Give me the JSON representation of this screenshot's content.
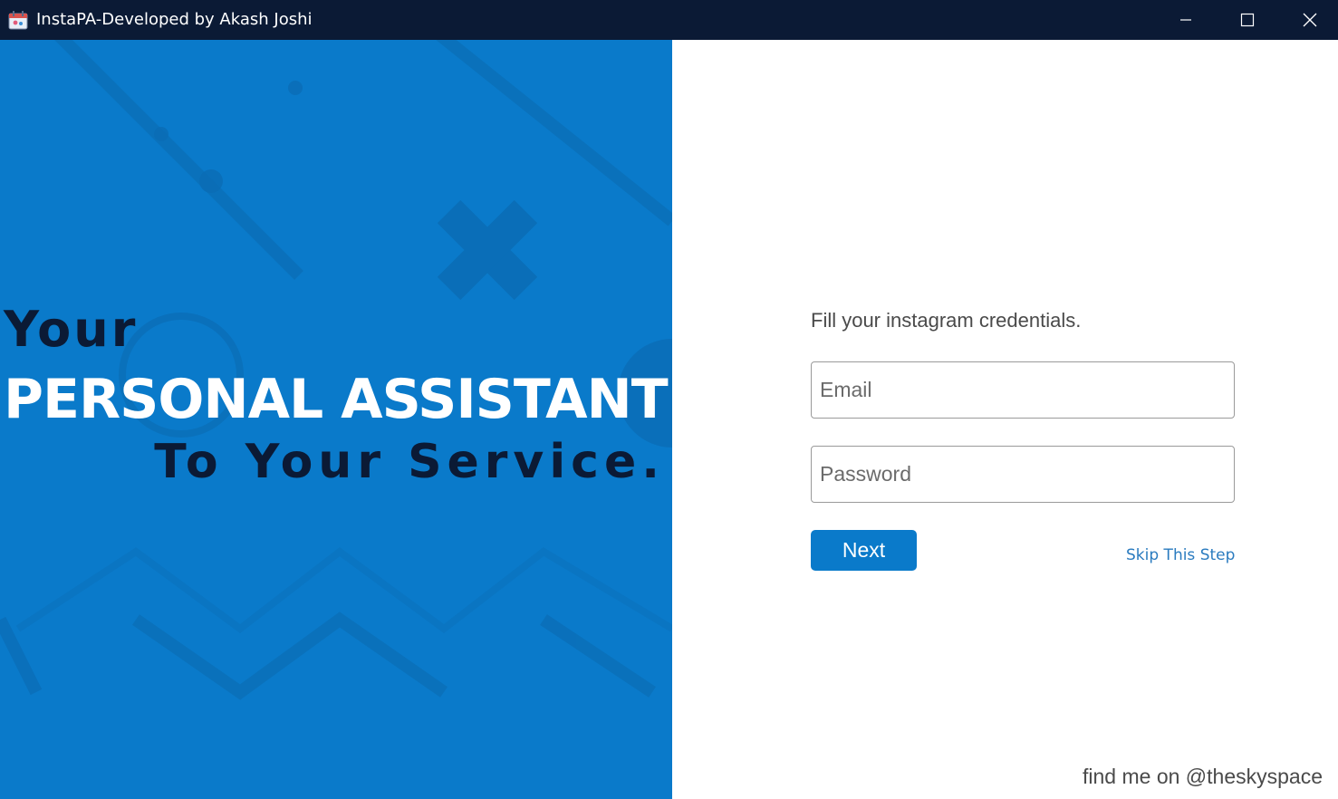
{
  "window": {
    "title": "InstaPA-Developed by Akash Joshi",
    "icon": "app-calendar-icon",
    "controls": [
      "minimize-icon",
      "maximize-icon",
      "close-icon"
    ]
  },
  "hero": {
    "line1": "Your",
    "line2": "PERSONAL ASSISTANT",
    "line3": "To Your Service."
  },
  "form": {
    "instructions": "Fill your instagram credentials.",
    "email_placeholder": "Email",
    "password_placeholder": "Password",
    "next_label": "Next",
    "skip_label": "Skip This Step"
  },
  "footer": {
    "credit": "find me on @theskyspace"
  },
  "colors": {
    "titlebar": "#0b1a35",
    "panel_blue": "#0a7aca",
    "hero_dark": "#0b1a35",
    "link": "#2a7bbf"
  }
}
